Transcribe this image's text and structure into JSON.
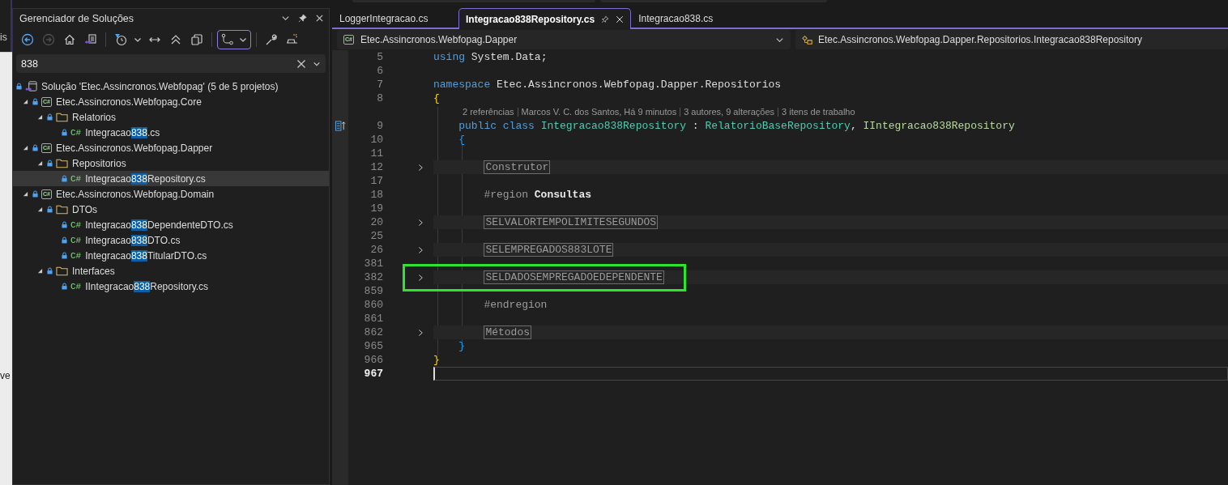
{
  "left_edge": {
    "top_text": "is",
    "lower_text": "ve"
  },
  "solution_explorer": {
    "title": "Gerenciador de Soluções",
    "toolbar": [
      {
        "kind": "back",
        "disabled": false,
        "on": false
      },
      {
        "kind": "forward",
        "disabled": true,
        "on": false
      },
      {
        "kind": "home",
        "disabled": false,
        "on": false
      },
      {
        "kind": "switch_views",
        "disabled": false,
        "on": false
      },
      {
        "kind": "separator"
      },
      {
        "kind": "pending_filter",
        "disabled": false,
        "on": false
      },
      {
        "kind": "caret",
        "disabled": false,
        "on": false
      },
      {
        "kind": "sync",
        "disabled": false,
        "on": false
      },
      {
        "kind": "collapse",
        "disabled": false,
        "on": false
      },
      {
        "kind": "copy",
        "disabled": false,
        "on": false
      },
      {
        "kind": "separator"
      },
      {
        "kind": "branch",
        "disabled": false,
        "on": true
      },
      {
        "kind": "separator"
      },
      {
        "kind": "wrench",
        "disabled": false,
        "on": false
      },
      {
        "kind": "preview",
        "disabled": false,
        "on": false
      }
    ],
    "search": {
      "value": "838"
    },
    "tree": [
      {
        "kind": "solution",
        "label": [
          {
            "text": "Solução 'Etec.Assincronos.Webfopag' (5 de 5 projetos)",
            "match": false
          }
        ],
        "selected": false,
        "children": [
          {
            "kind": "project",
            "badge": "C#",
            "expanded": true,
            "selected": false,
            "label": [
              {
                "text": "Etec.Assincronos.Webfopag.Core",
                "match": false
              }
            ],
            "children": [
              {
                "kind": "folder",
                "expanded": true,
                "selected": false,
                "label": [
                  {
                    "text": "Relatorios",
                    "match": false
                  }
                ],
                "children": [
                  {
                    "kind": "file",
                    "badge": "C#",
                    "selected": false,
                    "label": [
                      {
                        "text": "Integracao",
                        "match": false
                      },
                      {
                        "text": "838",
                        "match": true
                      },
                      {
                        "text": ".cs",
                        "match": false
                      }
                    ]
                  }
                ]
              }
            ]
          },
          {
            "kind": "project",
            "badge": "C#",
            "expanded": true,
            "selected": false,
            "label": [
              {
                "text": "Etec.Assincronos.Webfopag.Dapper",
                "match": false
              }
            ],
            "children": [
              {
                "kind": "folder",
                "expanded": true,
                "selected": false,
                "label": [
                  {
                    "text": "Repositorios",
                    "match": false
                  }
                ],
                "children": [
                  {
                    "kind": "file",
                    "badge": "C#",
                    "selected": true,
                    "label": [
                      {
                        "text": "Integracao",
                        "match": false
                      },
                      {
                        "text": "838",
                        "match": true
                      },
                      {
                        "text": "Repository.cs",
                        "match": false
                      }
                    ]
                  }
                ]
              }
            ]
          },
          {
            "kind": "project",
            "badge": "C#",
            "expanded": true,
            "selected": false,
            "label": [
              {
                "text": "Etec.Assincronos.Webfopag.Domain",
                "match": false
              }
            ],
            "children": [
              {
                "kind": "folder",
                "expanded": true,
                "selected": false,
                "label": [
                  {
                    "text": "DTOs",
                    "match": false
                  }
                ],
                "children": [
                  {
                    "kind": "file",
                    "badge": "C#",
                    "selected": false,
                    "label": [
                      {
                        "text": "Integracao",
                        "match": false
                      },
                      {
                        "text": "838",
                        "match": true
                      },
                      {
                        "text": "DependenteDTO.cs",
                        "match": false
                      }
                    ]
                  },
                  {
                    "kind": "file",
                    "badge": "C#",
                    "selected": false,
                    "label": [
                      {
                        "text": "Integracao",
                        "match": false
                      },
                      {
                        "text": "838",
                        "match": true
                      },
                      {
                        "text": "DTO.cs",
                        "match": false
                      }
                    ]
                  },
                  {
                    "kind": "file",
                    "badge": "C#",
                    "selected": false,
                    "label": [
                      {
                        "text": "Integracao",
                        "match": false
                      },
                      {
                        "text": "838",
                        "match": true
                      },
                      {
                        "text": "TitularDTO.cs",
                        "match": false
                      }
                    ]
                  }
                ]
              },
              {
                "kind": "folder",
                "expanded": true,
                "selected": false,
                "label": [
                  {
                    "text": "Interfaces",
                    "match": false
                  }
                ],
                "children": [
                  {
                    "kind": "file",
                    "badge": "C#",
                    "selected": false,
                    "label": [
                      {
                        "text": "IIntegracao",
                        "match": false
                      },
                      {
                        "text": "838",
                        "match": true
                      },
                      {
                        "text": "Repository.cs",
                        "match": false
                      }
                    ]
                  }
                ]
              }
            ]
          }
        ]
      }
    ]
  },
  "editor": {
    "tabs": [
      {
        "label": "LoggerIntegracao.cs",
        "selected": false
      },
      {
        "label": "Integracao838Repository.cs",
        "selected": true
      },
      {
        "label": "Integracao838.cs",
        "selected": false
      }
    ],
    "nav": {
      "project_badge": "C#",
      "project": "Etec.Assincronos.Webfopag.Dapper",
      "class": "Etec.Assincronos.Webfopag.Dapper.Repositorios.Integracao838Repository"
    },
    "lines": [
      {
        "kind": "code",
        "number": "5",
        "tokens": [
          {
            "kind": "keyword",
            "text": "using"
          },
          {
            "kind": "plain",
            "text": "System.Data;"
          }
        ]
      },
      {
        "kind": "code",
        "number": "6"
      },
      {
        "kind": "code",
        "number": "7",
        "tokens": [
          {
            "kind": "keyword",
            "text": "namespace"
          },
          {
            "kind": "plain",
            "text": "Etec.Assincronos.Webfopag.Dapper.Repositorios"
          }
        ]
      },
      {
        "kind": "code",
        "number": "8",
        "tokens": [
          {
            "kind": "brace_outer",
            "text": "{"
          }
        ]
      },
      {
        "kind": "lens",
        "parts": [
          "2 referências",
          "Marcos V. C. dos Santos, Há 9 minutos",
          "3 autores, 9 alterações",
          "3 itens de trabalho"
        ]
      },
      {
        "kind": "namespace_member",
        "number": "9",
        "gutter_icon": true,
        "tokens": [
          {
            "kind": "keyword",
            "text": "public class"
          },
          {
            "kind": "type",
            "text": "Integracao838Repository"
          },
          {
            "kind": "plain",
            "text": " : "
          },
          {
            "kind": "type",
            "text": "RelatorioBaseRepository"
          },
          {
            "kind": "plain",
            "text": ", "
          },
          {
            "kind": "interface",
            "text": "IIntegracao838Repository"
          }
        ]
      },
      {
        "kind": "namespace_member",
        "number": "10",
        "tokens": [
          {
            "kind": "brace_inner",
            "text": "{"
          }
        ]
      },
      {
        "kind": "code",
        "number": "11"
      },
      {
        "kind": "class_member",
        "number": "12",
        "folded": true,
        "tokens": [
          {
            "kind": "region",
            "text": "Construtor"
          }
        ]
      },
      {
        "kind": "code",
        "number": "17"
      },
      {
        "kind": "class_member",
        "number": "18",
        "tokens": [
          {
            "kind": "directive",
            "text": "#region"
          },
          {
            "kind": "bold",
            "text": "Consultas"
          }
        ]
      },
      {
        "kind": "code",
        "number": "19"
      },
      {
        "kind": "class_member",
        "number": "20",
        "folded": true,
        "tokens": [
          {
            "kind": "region",
            "text": "SELVALORTEMPOLIMITESEGUNDOS"
          }
        ]
      },
      {
        "kind": "code",
        "number": "25"
      },
      {
        "kind": "class_member",
        "number": "26",
        "folded": true,
        "tokens": [
          {
            "kind": "region",
            "text": "SELEMPREGADOS883LOTE"
          }
        ]
      },
      {
        "kind": "code",
        "number": "381"
      },
      {
        "kind": "class_member",
        "number": "382",
        "folded": true,
        "highlighted": true,
        "tokens": [
          {
            "kind": "region",
            "text": "SELDADOSEMPREGADOEDEPENDENTE"
          }
        ]
      },
      {
        "kind": "code",
        "number": "859"
      },
      {
        "kind": "class_member",
        "number": "860",
        "tokens": [
          {
            "kind": "directive",
            "text": "#endregion"
          }
        ]
      },
      {
        "kind": "code",
        "number": "861"
      },
      {
        "kind": "class_member",
        "number": "862",
        "folded": true,
        "tokens": [
          {
            "kind": "region",
            "text": "Métodos"
          }
        ]
      },
      {
        "kind": "namespace_member",
        "number": "965",
        "tokens": [
          {
            "kind": "brace_inner",
            "text": "}"
          }
        ]
      },
      {
        "kind": "code",
        "number": "966",
        "tokens": [
          {
            "kind": "brace_outer",
            "text": "}"
          }
        ]
      },
      {
        "kind": "code",
        "number": "967",
        "current": true
      }
    ]
  }
}
